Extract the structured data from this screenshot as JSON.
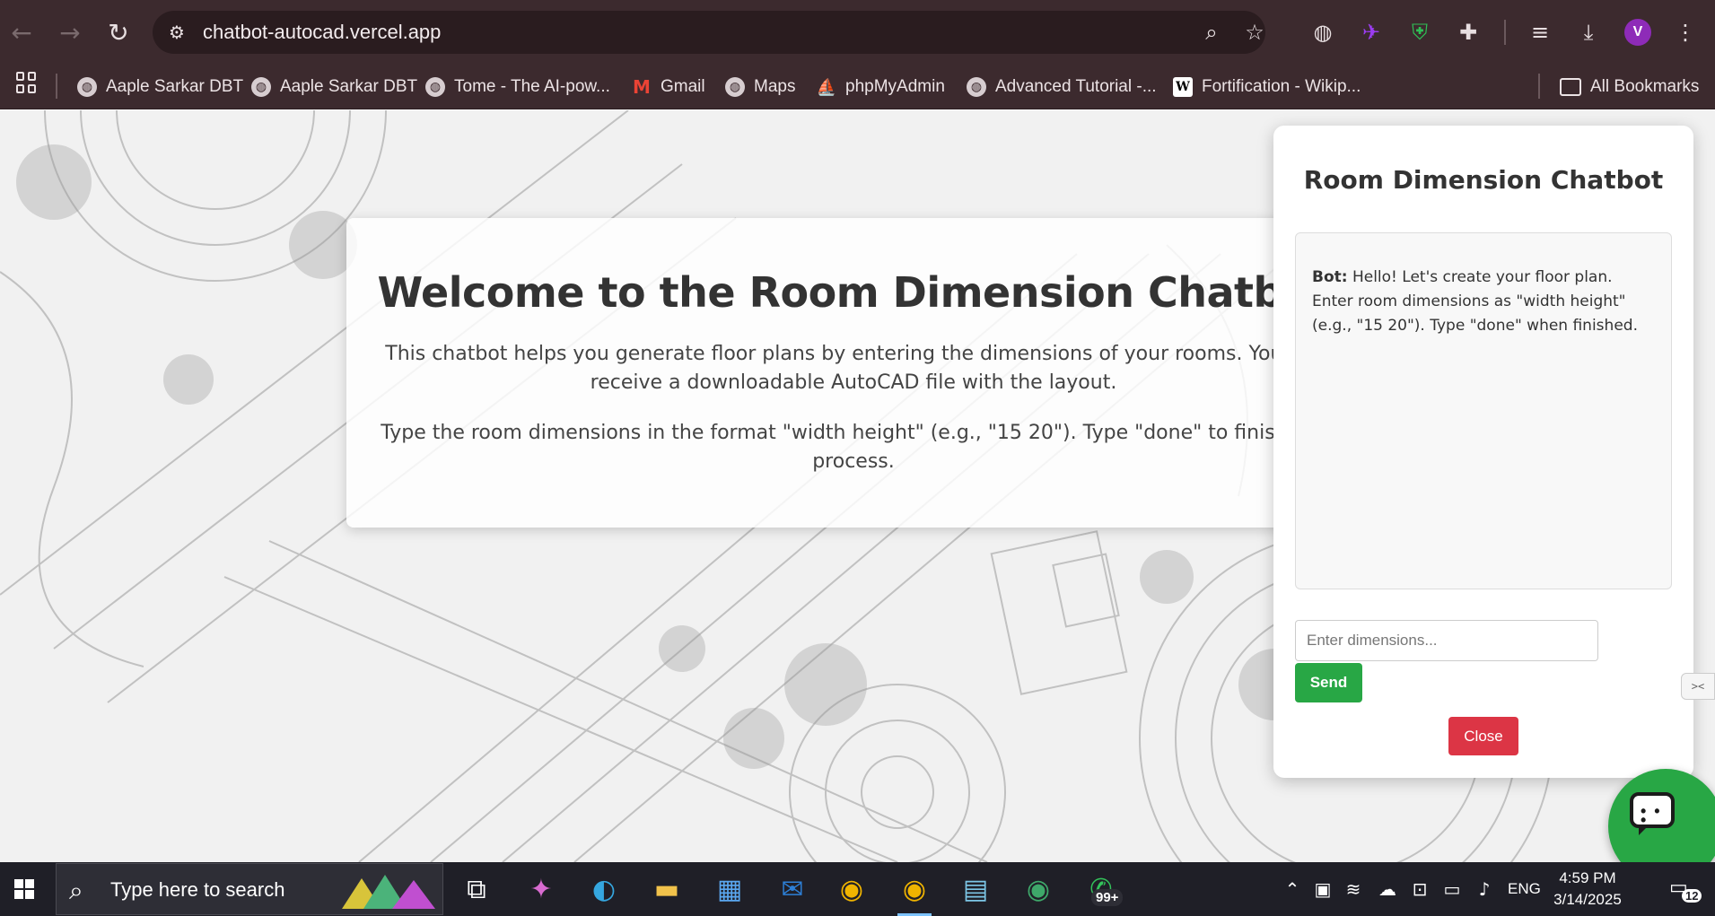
{
  "browser": {
    "url": "chatbot-autocad.vercel.app",
    "bookmarks": [
      {
        "label": "Aaple Sarkar DBT",
        "icon": "globe-icon"
      },
      {
        "label": "Aaple Sarkar DBT",
        "icon": "globe-icon"
      },
      {
        "label": "Tome - The AI-pow...",
        "icon": "globe-icon"
      },
      {
        "label": "Gmail",
        "icon": "gmail-icon"
      },
      {
        "label": "Maps",
        "icon": "globe-icon"
      },
      {
        "label": "phpMyAdmin",
        "icon": "phpmyadmin-icon"
      },
      {
        "label": "Advanced Tutorial -...",
        "icon": "globe-icon"
      },
      {
        "label": "Fortification - Wikip...",
        "icon": "wikipedia-icon"
      }
    ],
    "all_bookmarks": "All Bookmarks",
    "profile_initial": "V"
  },
  "welcome": {
    "title": "Welcome to the Room Dimension Chatbot",
    "intro": "This chatbot helps you generate floor plans by entering the dimensions of your rooms. You will receive a downloadable AutoCAD file with the layout.",
    "instructions": "Type the room dimensions in the format \"width height\" (e.g., \"15 20\"). Type \"done\" to finish the process."
  },
  "chat": {
    "title": "Room Dimension Chatbot",
    "bot_label": "Bot:",
    "bot_message": "Hello! Let's create your floor plan. Enter room dimensions as \"width height\" (e.g., \"15 20\"). Type \"done\" when finished.",
    "input_placeholder": "Enter dimensions...",
    "send_label": "Send",
    "close_label": "Close"
  },
  "side_tab": "><",
  "taskbar": {
    "search_placeholder": "Type here to search",
    "whatsapp_badge": "99+",
    "language": "ENG",
    "time": "4:59 PM",
    "date": "3/14/2025",
    "notification_count": "12"
  },
  "colors": {
    "chrome_bg": "#3c2a2e",
    "send_green": "#28a745",
    "close_red": "#dc3545",
    "taskbar_bg": "#1f1f27"
  }
}
